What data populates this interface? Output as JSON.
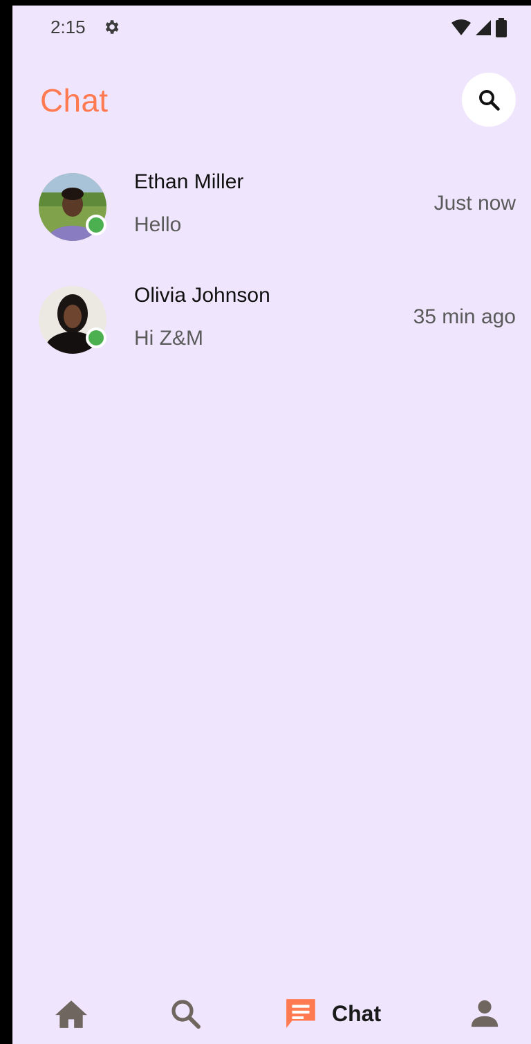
{
  "status_bar": {
    "time": "2:15",
    "icons": [
      "gear-icon",
      "wifi-icon",
      "signal-icon",
      "battery-icon"
    ]
  },
  "header": {
    "title": "Chat",
    "search_icon": "search-icon"
  },
  "chats": [
    {
      "name": "Ethan Miller",
      "message": "Hello",
      "time": "Just now",
      "online": true
    },
    {
      "name": "Olivia Johnson",
      "message": "Hi Z&M",
      "time": "35 min ago",
      "online": true
    }
  ],
  "bottom_nav": {
    "items": [
      {
        "icon": "home-icon",
        "label": ""
      },
      {
        "icon": "search-icon",
        "label": ""
      },
      {
        "icon": "chat-icon",
        "label": "Chat",
        "active": true
      },
      {
        "icon": "person-icon",
        "label": ""
      }
    ]
  },
  "colors": {
    "background": "#efe5fd",
    "accent": "#ff7a50",
    "online": "#4caf50"
  }
}
